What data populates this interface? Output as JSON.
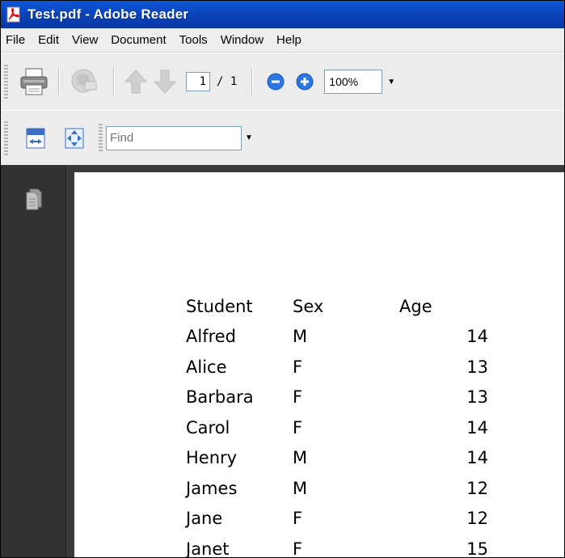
{
  "window": {
    "title": "Test.pdf - Adobe Reader",
    "app_icon": "adobe-reader-icon"
  },
  "menu": [
    "File",
    "Edit",
    "View",
    "Document",
    "Tools",
    "Window",
    "Help"
  ],
  "toolbar": {
    "page_current": "1",
    "page_total": "/ 1",
    "zoom": "100%",
    "find_placeholder": "Find",
    "icons": [
      "print-icon",
      "email-icon",
      "previous-page-icon",
      "next-page-icon",
      "zoom-out-icon",
      "zoom-in-icon",
      "fit-width-icon",
      "fit-page-icon"
    ]
  },
  "nav_panel": {
    "icon": "pages-icon"
  },
  "document": {
    "headers": [
      "Student",
      "Sex",
      "Age"
    ],
    "rows": [
      [
        "Alfred",
        "M",
        "14"
      ],
      [
        "Alice",
        "F",
        "13"
      ],
      [
        "Barbara",
        "F",
        "13"
      ],
      [
        "Carol",
        "F",
        "14"
      ],
      [
        "Henry",
        "M",
        "14"
      ],
      [
        "James",
        "M",
        "12"
      ],
      [
        "Jane",
        "F",
        "12"
      ],
      [
        "Janet",
        "F",
        "15"
      ]
    ]
  },
  "colors": {
    "titlebar": "#0a3fb5",
    "viewer_bg": "#3a3a3a",
    "zoom_button": "#1e6fd8"
  }
}
